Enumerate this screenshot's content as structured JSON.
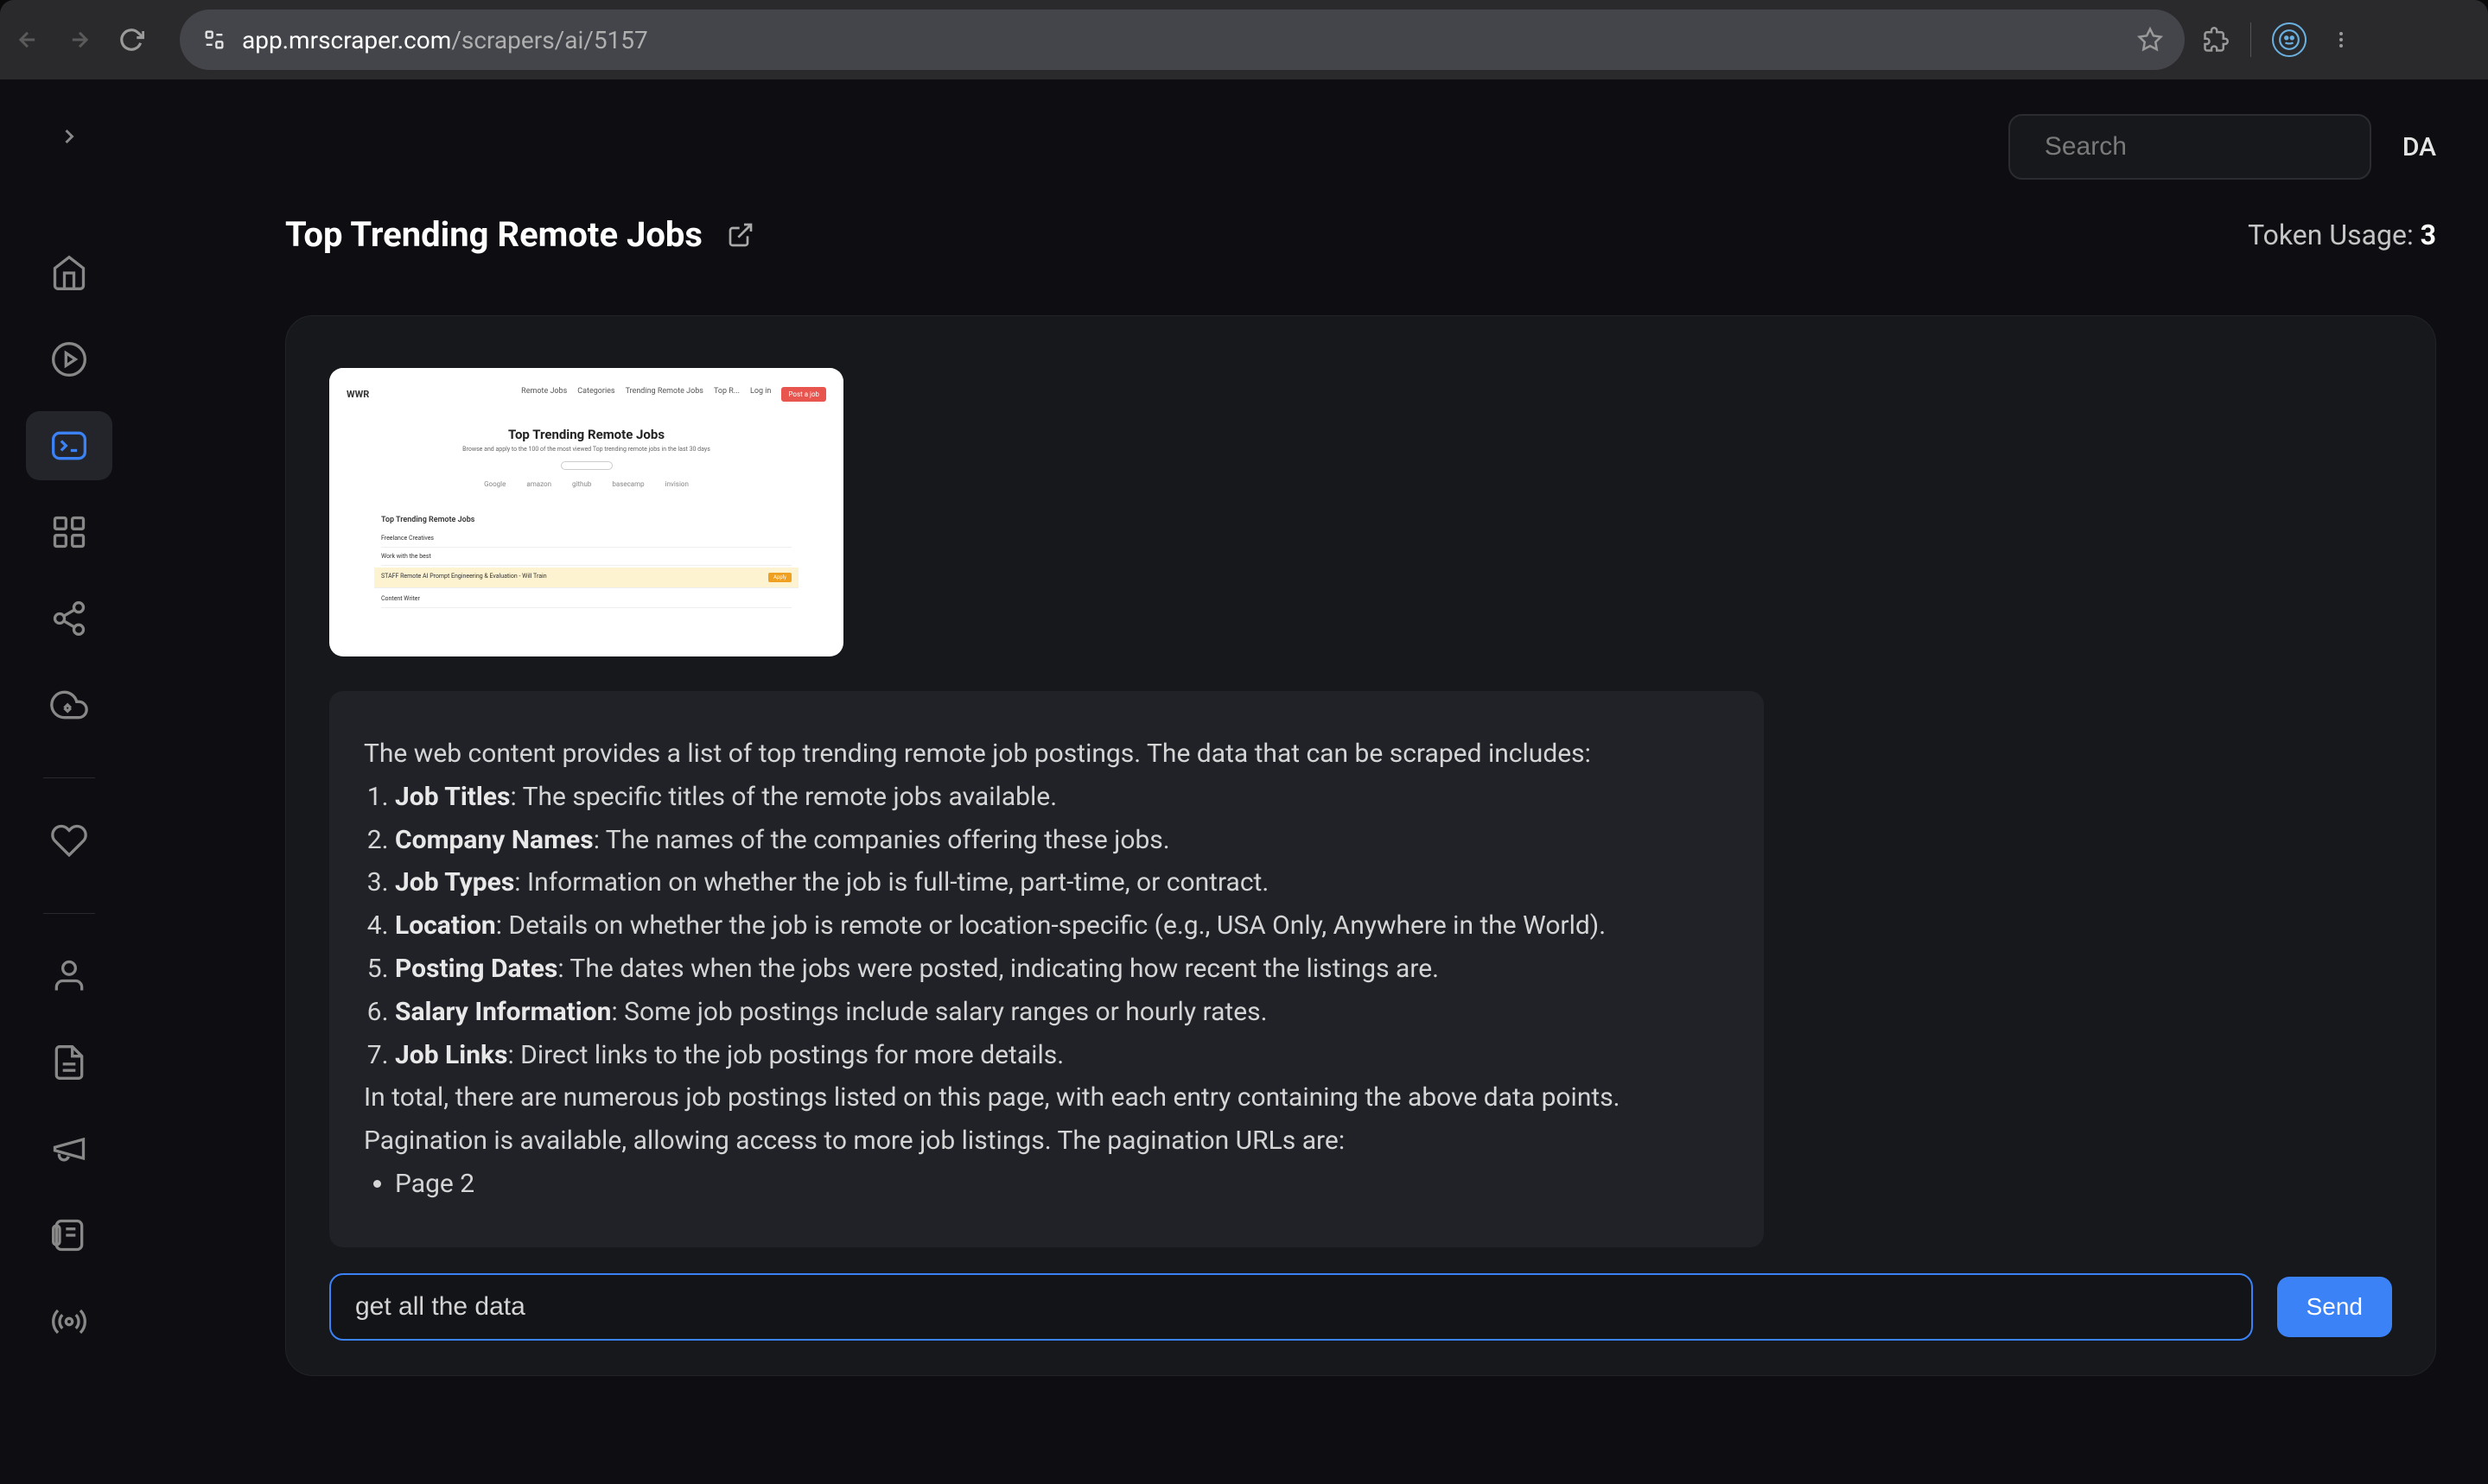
{
  "browser": {
    "url_domain": "app.mrscraper.com",
    "url_path": "/scrapers/ai/5157"
  },
  "topbar": {
    "search_placeholder": "Search",
    "user_initials": "DA"
  },
  "header": {
    "title": "Top Trending Remote Jobs",
    "token_usage_label": "Token Usage: ",
    "token_usage_value": "3"
  },
  "preview": {
    "logo": "WWR",
    "nav": [
      "Remote Jobs",
      "Categories",
      "Trending Remote Jobs",
      "Top R...",
      "Log in"
    ],
    "post_btn": "Post a job",
    "hero_title": "Top Trending Remote Jobs",
    "hero_sub": "Browse and apply to the 100 of the most viewed Top trending remote jobs in the last 30 days",
    "logos": [
      "Google",
      "amazon",
      "github",
      "basecamp",
      "invision"
    ],
    "jobs_title": "Top Trending Remote Jobs",
    "rows": [
      "Freelance Creatives",
      "Work with the best",
      "STAFF Remote AI Prompt Engineering & Evaluation - Will Train",
      "Content Writer"
    ]
  },
  "response": {
    "intro": "The web content provides a list of top trending remote job postings. The data that can be scraped includes:",
    "items": [
      {
        "label": "Job Titles",
        "desc": ": The specific titles of the remote jobs available."
      },
      {
        "label": "Company Names",
        "desc": ": The names of the companies offering these jobs."
      },
      {
        "label": "Job Types",
        "desc": ": Information on whether the job is full-time, part-time, or contract."
      },
      {
        "label": "Location",
        "desc": ": Details on whether the job is remote or location-specific (e.g., USA Only, Anywhere in the World)."
      },
      {
        "label": "Posting Dates",
        "desc": ": The dates when the jobs were posted, indicating how recent the listings are."
      },
      {
        "label": "Salary Information",
        "desc": ": Some job postings include salary ranges or hourly rates."
      },
      {
        "label": "Job Links",
        "desc": ": Direct links to the job postings for more details."
      }
    ],
    "summary": "In total, there are numerous job postings listed on this page, with each entry containing the above data points. Pagination is available, allowing access to more job listings. The pagination URLs are:",
    "pagination": [
      "Page 2"
    ]
  },
  "input": {
    "value": "get all the data",
    "send_label": "Send"
  }
}
